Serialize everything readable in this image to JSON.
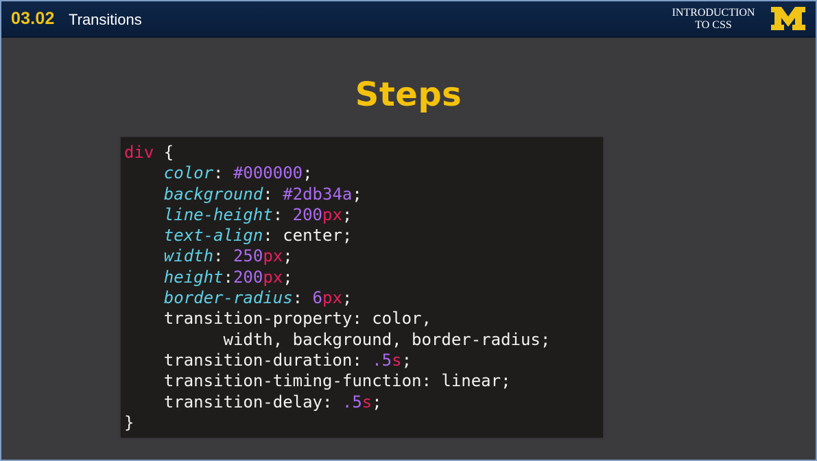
{
  "header": {
    "lesson_number": "03.02",
    "lesson_title": "Transitions",
    "course_line1": "INTRODUCTION",
    "course_line2": "TO CSS",
    "logo_letter": "M",
    "logo_icon": "university-of-michigan-block-m-icon"
  },
  "slide": {
    "title": "Steps"
  },
  "code": {
    "selector": "div",
    "open_brace": " {",
    "close_brace": "}",
    "lines": [
      {
        "prop": "color",
        "sep": ": ",
        "val": "#000000",
        "unit": "",
        "end": ";"
      },
      {
        "prop": "background",
        "sep": ": ",
        "val": "#2db34a",
        "unit": "",
        "end": ";"
      },
      {
        "prop": "line-height",
        "sep": ": ",
        "val": "200",
        "unit": "px",
        "end": ";"
      },
      {
        "prop": "text-align",
        "sep": ": ",
        "val": "center",
        "unit": "",
        "end": ";"
      },
      {
        "prop": "width",
        "sep": ": ",
        "val": "250",
        "unit": "px",
        "end": ";"
      },
      {
        "prop": "height",
        "sep": ":",
        "val": "200",
        "unit": "px",
        "end": ";"
      },
      {
        "prop": "border-radius",
        "sep": ": ",
        "val": "6",
        "unit": "px",
        "end": ";"
      }
    ],
    "transition_property_line1": "transition-property: color,",
    "transition_property_line2": "width, background, border-radius;",
    "transition_duration_label": "transition-duration: ",
    "transition_duration_val": ".5",
    "transition_duration_unit": "s",
    "transition_timing_line": "transition-timing-function: linear;",
    "transition_delay_label": "transition-delay: ",
    "transition_delay_val": ".5",
    "transition_delay_unit": "s",
    "semicolon": ";"
  },
  "colors": {
    "header_bg": "#0e2648",
    "accent_maize": "#f1c317",
    "slide_bg": "#3b3b3d",
    "code_bg": "#1f1d1b",
    "selector": "#e6205d",
    "property": "#5fd0e8",
    "value": "#ab6bf2",
    "unit": "#e6205d"
  }
}
